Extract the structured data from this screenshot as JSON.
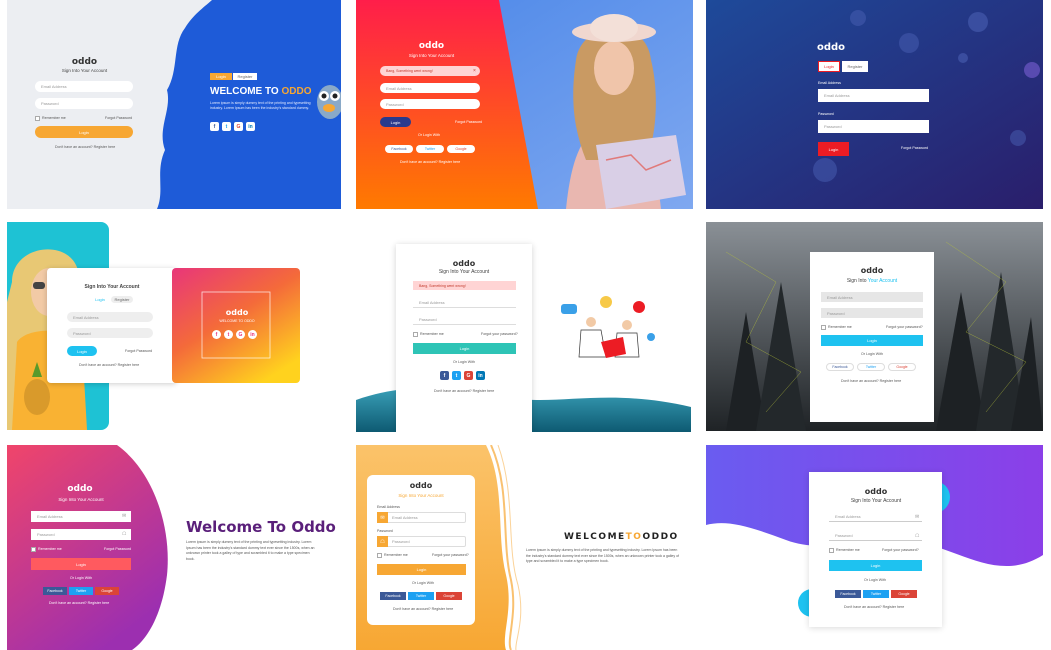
{
  "brand": "oddo",
  "sign_in": "Sign Into Your Account",
  "sign_in_prefix": "Sign Into",
  "sign_in_suffix": "Your Account",
  "email_placeholder": "Email Address",
  "password_placeholder": "Password",
  "remember": "Remember me",
  "forgot_cap": "Forgot Password",
  "forgot_q": "Forgot your password?",
  "login": "Login",
  "register": "Register",
  "no_account": "Don't have an account? Register here",
  "or_login_with": "Or Login With",
  "alert": "Bang, Something went wrong!",
  "alert_close": "×",
  "welcome_upper": "WELCOME TO",
  "welcome_highlight": "ODDO",
  "welcome_title": "Welcome To Oddo",
  "welcome_letter_a": "WELCOME",
  "welcome_letter_b": "TO",
  "welcome_letter_c": "ODDO",
  "welcome_small": "WELCOME TO ODDO",
  "lorem_short": "Lorem ipsum is simply dummy text of the printing and typesetting industry. Lorem Ipsum has been the industry's standard dummy.",
  "lorem_long": "Lorem ipsum is simply dummy text of the printing and typesetting industry. Lorem Ipsum has been the industry's standard dummy text ever since the 1500s, when an unknown printer took a galley of type and scrambled it to make a type specimen book.",
  "social": {
    "facebook": "Facebook",
    "twitter": "Twitter",
    "google": "Google",
    "f": "f",
    "t": "t",
    "g": "G",
    "in": "in"
  },
  "colors": {
    "orange": "#f7a733",
    "blue": "#1e5bd8",
    "red": "#ec1c24",
    "navy": "#1b2a6b",
    "cyan": "#1ec2f0",
    "teal": "#2ec4b6",
    "magenta": "#e8367a",
    "purple": "#7b3fe4",
    "fb": "#3b5998",
    "tw": "#1da1f2",
    "gp": "#db4437",
    "li": "#0077b5"
  },
  "icons": [
    "envelope-icon",
    "lock-icon",
    "checkbox-icon",
    "facebook-icon",
    "twitter-icon",
    "google-icon",
    "linkedin-icon",
    "close-icon",
    "mascot-icon"
  ]
}
